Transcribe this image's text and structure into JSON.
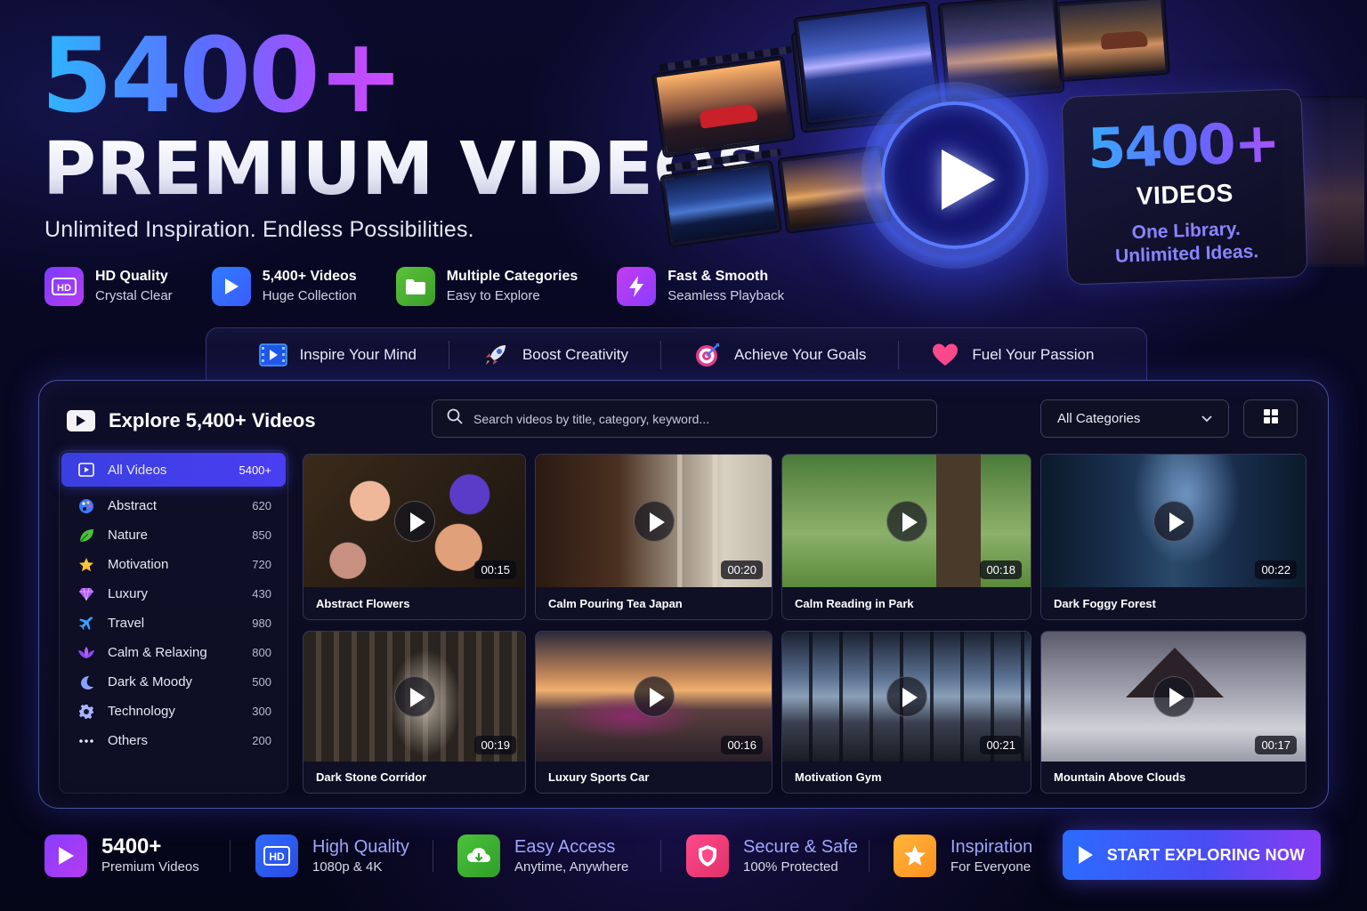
{
  "hero": {
    "number": "5400+",
    "title": "PREMIUM VIDEOS",
    "subtitle": "Unlimited Inspiration. Endless Possibilities.",
    "features": [
      {
        "title": "HD Quality",
        "sub": "Crystal Clear",
        "icon": "hd-icon"
      },
      {
        "title": "5,400+ Videos",
        "sub": "Huge Collection",
        "icon": "play-icon"
      },
      {
        "title": "Multiple Categories",
        "sub": "Easy to Explore",
        "icon": "folder-icon"
      },
      {
        "title": "Fast & Smooth",
        "sub": "Seamless Playback",
        "icon": "lightning-icon"
      }
    ]
  },
  "promo": {
    "number": "5400+",
    "label": "VIDEOS",
    "tagline1": "One Library.",
    "tagline2": "Unlimited Ideas."
  },
  "benefits": [
    {
      "label": "Inspire Your Mind",
      "icon": "film-icon"
    },
    {
      "label": "Boost Creativity",
      "icon": "rocket-icon"
    },
    {
      "label": "Achieve Your Goals",
      "icon": "target-icon"
    },
    {
      "label": "Fuel Your Passion",
      "icon": "heart-icon"
    }
  ],
  "explorer": {
    "title": "Explore 5,400+ Videos",
    "search_placeholder": "Search videos by title, category, keyword...",
    "category_select": "All Categories",
    "categories": [
      {
        "label": "All Videos",
        "count": "5400+",
        "icon": "video-icon",
        "active": true
      },
      {
        "label": "Abstract",
        "count": "620",
        "icon": "palette-icon"
      },
      {
        "label": "Nature",
        "count": "850",
        "icon": "leaf-icon"
      },
      {
        "label": "Motivation",
        "count": "720",
        "icon": "star-icon"
      },
      {
        "label": "Luxury",
        "count": "430",
        "icon": "diamond-icon"
      },
      {
        "label": "Travel",
        "count": "980",
        "icon": "airplane-icon"
      },
      {
        "label": "Calm & Relaxing",
        "count": "800",
        "icon": "lotus-icon"
      },
      {
        "label": "Dark & Moody",
        "count": "500",
        "icon": "moon-icon"
      },
      {
        "label": "Technology",
        "count": "300",
        "icon": "gear-icon"
      },
      {
        "label": "Others",
        "count": "200",
        "icon": "more-icon"
      }
    ],
    "videos": [
      {
        "title": "Abstract Flowers",
        "duration": "00:15"
      },
      {
        "title": "Calm Pouring Tea Japan",
        "duration": "00:20"
      },
      {
        "title": "Calm Reading in Park",
        "duration": "00:18"
      },
      {
        "title": "Dark Foggy Forest",
        "duration": "00:22"
      },
      {
        "title": "Dark Stone Corridor",
        "duration": "00:19"
      },
      {
        "title": "Luxury Sports Car",
        "duration": "00:16"
      },
      {
        "title": "Motivation Gym",
        "duration": "00:21"
      },
      {
        "title": "Mountain Above Clouds",
        "duration": "00:17"
      }
    ]
  },
  "stats": [
    {
      "title": "5400+",
      "sub": "Premium Videos",
      "icon": "play-icon"
    },
    {
      "title": "High Quality",
      "sub": "1080p & 4K",
      "icon": "hd-icon"
    },
    {
      "title": "Easy Access",
      "sub": "Anytime, Anywhere",
      "icon": "cloud-download-icon"
    },
    {
      "title": "Secure & Safe",
      "sub": "100% Protected",
      "icon": "shield-icon"
    },
    {
      "title": "Inspiration",
      "sub": "For Everyone",
      "icon": "star-icon"
    }
  ],
  "cta": {
    "label": "START EXPLORING NOW"
  }
}
